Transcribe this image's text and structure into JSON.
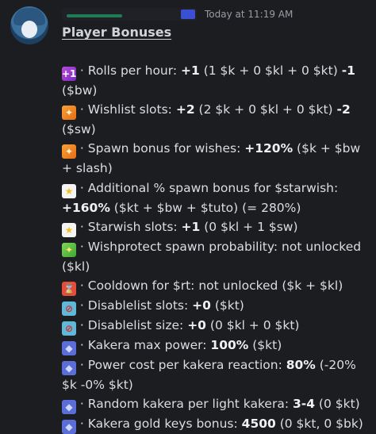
{
  "header": {
    "timestamp": "Today at 11:19 AM",
    "title": "Player Bonuses"
  },
  "lines": [
    {
      "icon": "plus-one-icon",
      "glyph": "+1",
      "cls": "ic-plus",
      "pre": "· Rolls per hour: ",
      "bold": "+1",
      "post": " (1 $k + 0 $kl + 0 $kt) ",
      "bold2": "-1",
      "post2": " ($bw)"
    },
    {
      "icon": "wishlist-icon",
      "glyph": "✦",
      "cls": "ic-wish",
      "pre": "· Wishlist slots: ",
      "bold": "+2",
      "post": " (2 $k + 0 $kl + 0 $kt) ",
      "bold2": "-2",
      "post2": " ($sw)"
    },
    {
      "icon": "wishlist-icon",
      "glyph": "✦",
      "cls": "ic-wish",
      "pre": "· Spawn bonus for wishes: ",
      "bold": "+120%",
      "post": " ($k + $bw + slash)",
      "bold2": "",
      "post2": ""
    },
    {
      "icon": "star-icon",
      "glyph": "★",
      "cls": "ic-star",
      "pre": "· Additional % spawn bonus for $starwish: ",
      "bold": "+160%",
      "post": " ($kt + $bw + $tuto) (= 280%)",
      "bold2": "",
      "post2": ""
    },
    {
      "icon": "star-icon",
      "glyph": "★",
      "cls": "ic-star",
      "pre": "· Starwish slots: ",
      "bold": "+1",
      "post": " (0 $kl + 1 $sw)",
      "bold2": "",
      "post2": ""
    },
    {
      "icon": "wishprotect-icon",
      "glyph": "✦",
      "cls": "ic-protect",
      "pre": "· Wishprotect spawn probability: not unlocked ($kl)",
      "bold": "",
      "post": "",
      "bold2": "",
      "post2": ""
    },
    {
      "icon": "hourglass-icon",
      "glyph": "⌛",
      "cls": "ic-hour",
      "pre": "· Cooldown for $rt: not unlocked ($k + $kl)",
      "bold": "",
      "post": "",
      "bold2": "",
      "post2": ""
    },
    {
      "icon": "no-entry-icon",
      "glyph": "⊘",
      "cls": "ic-ban",
      "pre": "· Disablelist slots: ",
      "bold": "+0",
      "post": " ($kt)",
      "bold2": "",
      "post2": ""
    },
    {
      "icon": "no-entry-icon",
      "glyph": "⊘",
      "cls": "ic-ban",
      "pre": "· Disablelist size: ",
      "bold": "+0",
      "post": " (0 $kl + 0 $kt)",
      "bold2": "",
      "post2": ""
    },
    {
      "icon": "kakera-icon",
      "glyph": "◆",
      "cls": "ic-kak",
      "pre": "· Kakera max power: ",
      "bold": "100%",
      "post": " ($kt)",
      "bold2": "",
      "post2": ""
    },
    {
      "icon": "kakera-icon",
      "glyph": "◆",
      "cls": "ic-kak",
      "pre": "· Power cost per kakera reaction: ",
      "bold": "80%",
      "post": " (-20% $k -0% $kt)",
      "bold2": "",
      "post2": ""
    },
    {
      "icon": "kakera-icon",
      "glyph": "◆",
      "cls": "ic-kak",
      "pre": "· Random kakera per light kakera: ",
      "bold": "3-4",
      "post": " (0 $kt)",
      "bold2": "",
      "post2": ""
    },
    {
      "icon": "kakera-icon",
      "glyph": "◆",
      "cls": "ic-kak",
      "pre": "· Kakera gold keys bonus: ",
      "bold": "4500",
      "post": " (0 $kt, 0 $bk)",
      "bold2": "",
      "post2": ""
    }
  ]
}
